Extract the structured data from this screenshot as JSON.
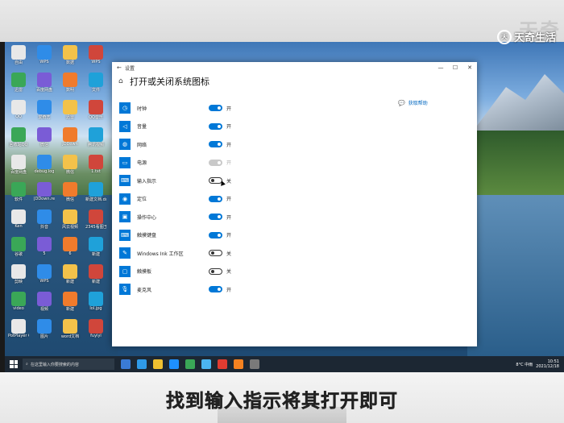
{
  "branding": {
    "logo_text": "天奇生活",
    "logo_mark": "天奇"
  },
  "desktop": {
    "icons": [
      "自由",
      "WPS",
      "数据",
      "WPS",
      "迅雷",
      "百度网盘",
      "数明",
      "文件",
      "QQ",
      "爱奇艺",
      "迅雷",
      "QQ音乐",
      "回收站QQ",
      "微信",
      "JDDown",
      "腾讯视频",
      "百度网盘",
      "debug.log",
      "微信",
      "1.txt",
      "软件",
      "JDDown.rer",
      "微信",
      "新建文档.docx",
      "Ken",
      "抖音",
      "风云视频",
      "2345看图王",
      "谷歌",
      "5",
      "6",
      "新建",
      "剪映",
      "WPS",
      "新建",
      "新建",
      "video",
      "视频",
      "新建",
      "lol.jpg",
      "PotPlayer 64 bit",
      "图片",
      "word文档",
      "fuyiyi"
    ]
  },
  "window": {
    "title": "设置",
    "back_glyph": "←",
    "minimize_glyph": "—",
    "maximize_glyph": "☐",
    "close_glyph": "✕",
    "home_glyph": "⌂",
    "page_title": "打开或关闭系统图标",
    "help_icon": "💬",
    "help_text": "获取帮助",
    "rows": [
      {
        "icon": "◷",
        "label": "时钟",
        "state": "开",
        "toggle": "on"
      },
      {
        "icon": "◁",
        "label": "音量",
        "state": "开",
        "toggle": "on"
      },
      {
        "icon": "◍",
        "label": "网络",
        "state": "开",
        "toggle": "on"
      },
      {
        "icon": "▭",
        "label": "电源",
        "state": "开",
        "toggle": "disabled"
      },
      {
        "icon": "⌨",
        "label": "输入指示",
        "state": "关",
        "toggle": "off"
      },
      {
        "icon": "◉",
        "label": "定位",
        "state": "开",
        "toggle": "on"
      },
      {
        "icon": "▣",
        "label": "操作中心",
        "state": "开",
        "toggle": "on"
      },
      {
        "icon": "⌨",
        "label": "触摸键盘",
        "state": "开",
        "toggle": "on"
      },
      {
        "icon": "✎",
        "label": "Windows Ink 工作区",
        "state": "关",
        "toggle": "off"
      },
      {
        "icon": "▢",
        "label": "触摸板",
        "state": "关",
        "toggle": "off"
      },
      {
        "icon": "🎙",
        "label": "麦克风",
        "state": "开",
        "toggle": "on"
      }
    ]
  },
  "taskbar": {
    "search_placeholder": "在这里输入你要搜索的内容",
    "weather": "8°C 中雨",
    "time": "10:51",
    "date": "2021/12/18"
  },
  "caption": "找到输入指示将其打开即可"
}
